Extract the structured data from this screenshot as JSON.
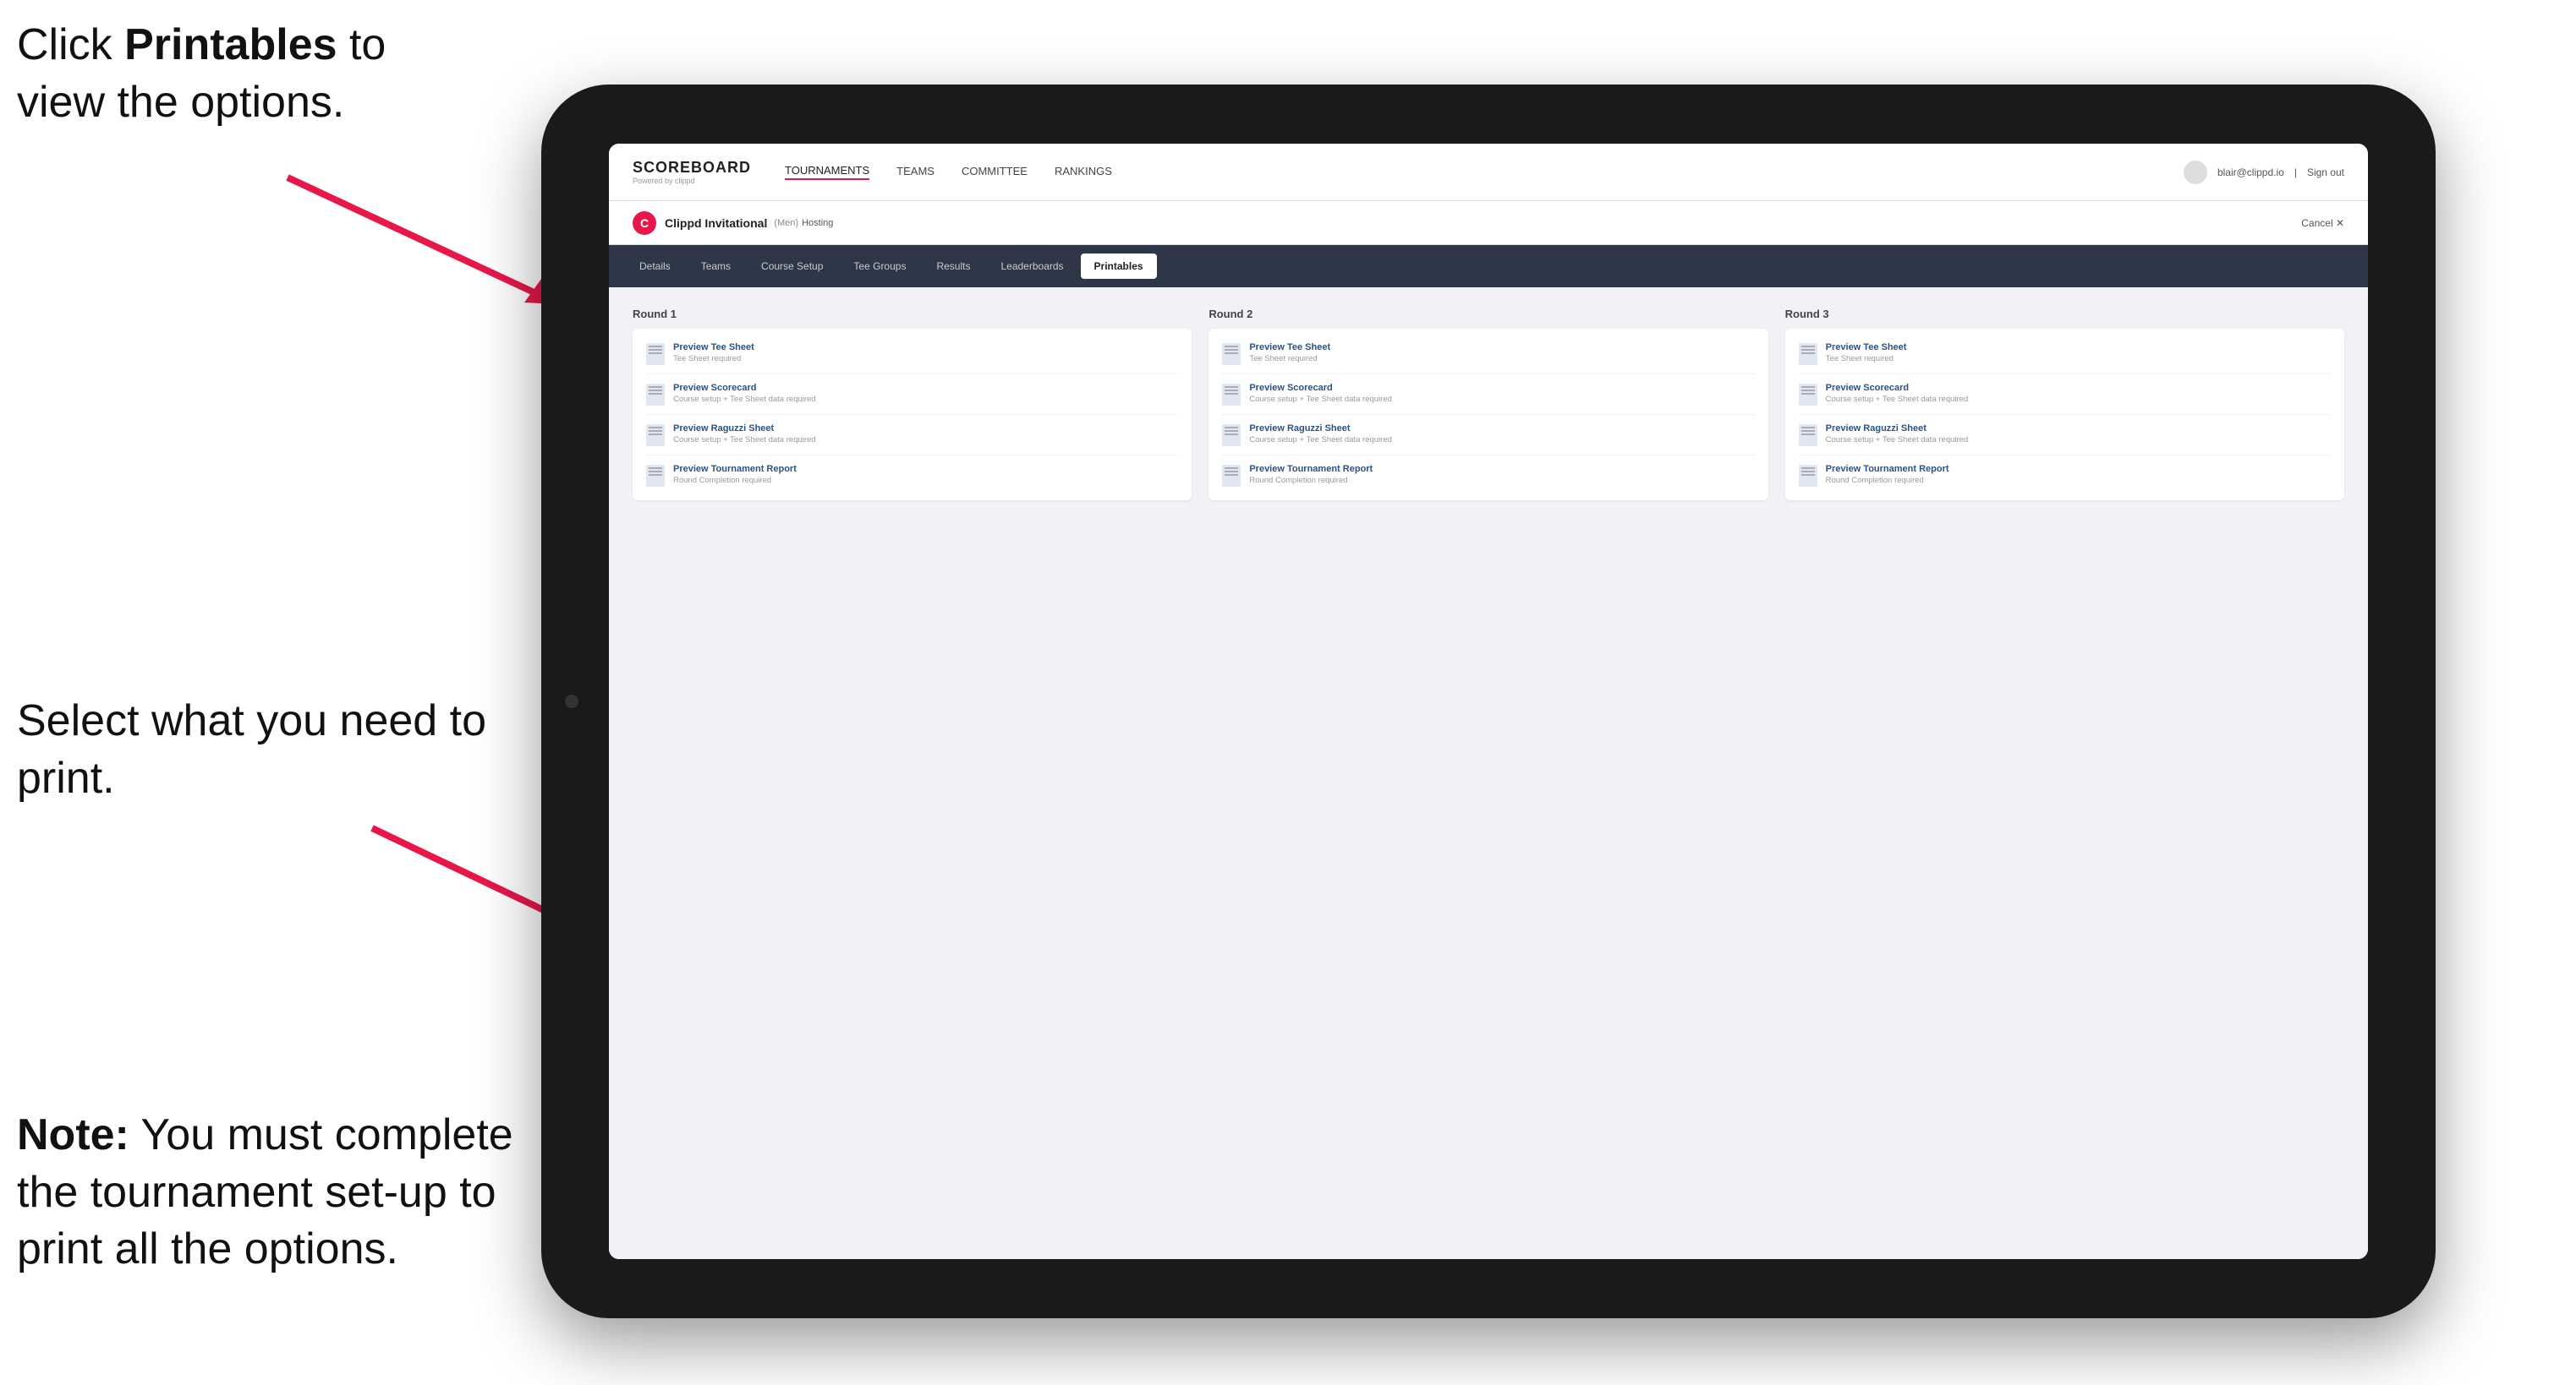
{
  "annotations": {
    "top_text_part1": "Click ",
    "top_text_bold": "Printables",
    "top_text_part2": " to view the options.",
    "mid_text": "Select what you need to print.",
    "bottom_note_bold": "Note:",
    "bottom_note_text": " You must complete the tournament set-up to print all the options."
  },
  "top_nav": {
    "logo": "SCOREBOARD",
    "logo_sub": "Powered by clippd",
    "links": [
      "TOURNAMENTS",
      "TEAMS",
      "COMMITTEE",
      "RANKINGS"
    ],
    "active_link": "TOURNAMENTS",
    "user_email": "blair@clippd.io",
    "sign_out": "Sign out"
  },
  "tournament_bar": {
    "logo_letter": "C",
    "name": "Clippd Invitational",
    "tag": "(Men)",
    "status": "Hosting",
    "cancel": "Cancel ✕"
  },
  "sub_nav": {
    "tabs": [
      "Details",
      "Teams",
      "Course Setup",
      "Tee Groups",
      "Results",
      "Leaderboards",
      "Printables"
    ],
    "active_tab": "Printables"
  },
  "rounds": [
    {
      "title": "Round 1",
      "items": [
        {
          "label": "Preview Tee Sheet",
          "sub": "Tee Sheet required"
        },
        {
          "label": "Preview Scorecard",
          "sub": "Course setup + Tee Sheet data required"
        },
        {
          "label": "Preview Raguzzi Sheet",
          "sub": "Course setup + Tee Sheet data required"
        },
        {
          "label": "Preview Tournament Report",
          "sub": "Round Completion required"
        }
      ]
    },
    {
      "title": "Round 2",
      "items": [
        {
          "label": "Preview Tee Sheet",
          "sub": "Tee Sheet required"
        },
        {
          "label": "Preview Scorecard",
          "sub": "Course setup + Tee Sheet data required"
        },
        {
          "label": "Preview Raguzzi Sheet",
          "sub": "Course setup + Tee Sheet data required"
        },
        {
          "label": "Preview Tournament Report",
          "sub": "Round Completion required"
        }
      ]
    },
    {
      "title": "Round 3",
      "items": [
        {
          "label": "Preview Tee Sheet",
          "sub": "Tee Sheet required"
        },
        {
          "label": "Preview Scorecard",
          "sub": "Course setup + Tee Sheet data required"
        },
        {
          "label": "Preview Raguzzi Sheet",
          "sub": "Course setup + Tee Sheet data required"
        },
        {
          "label": "Preview Tournament Report",
          "sub": "Round Completion required"
        }
      ]
    }
  ]
}
